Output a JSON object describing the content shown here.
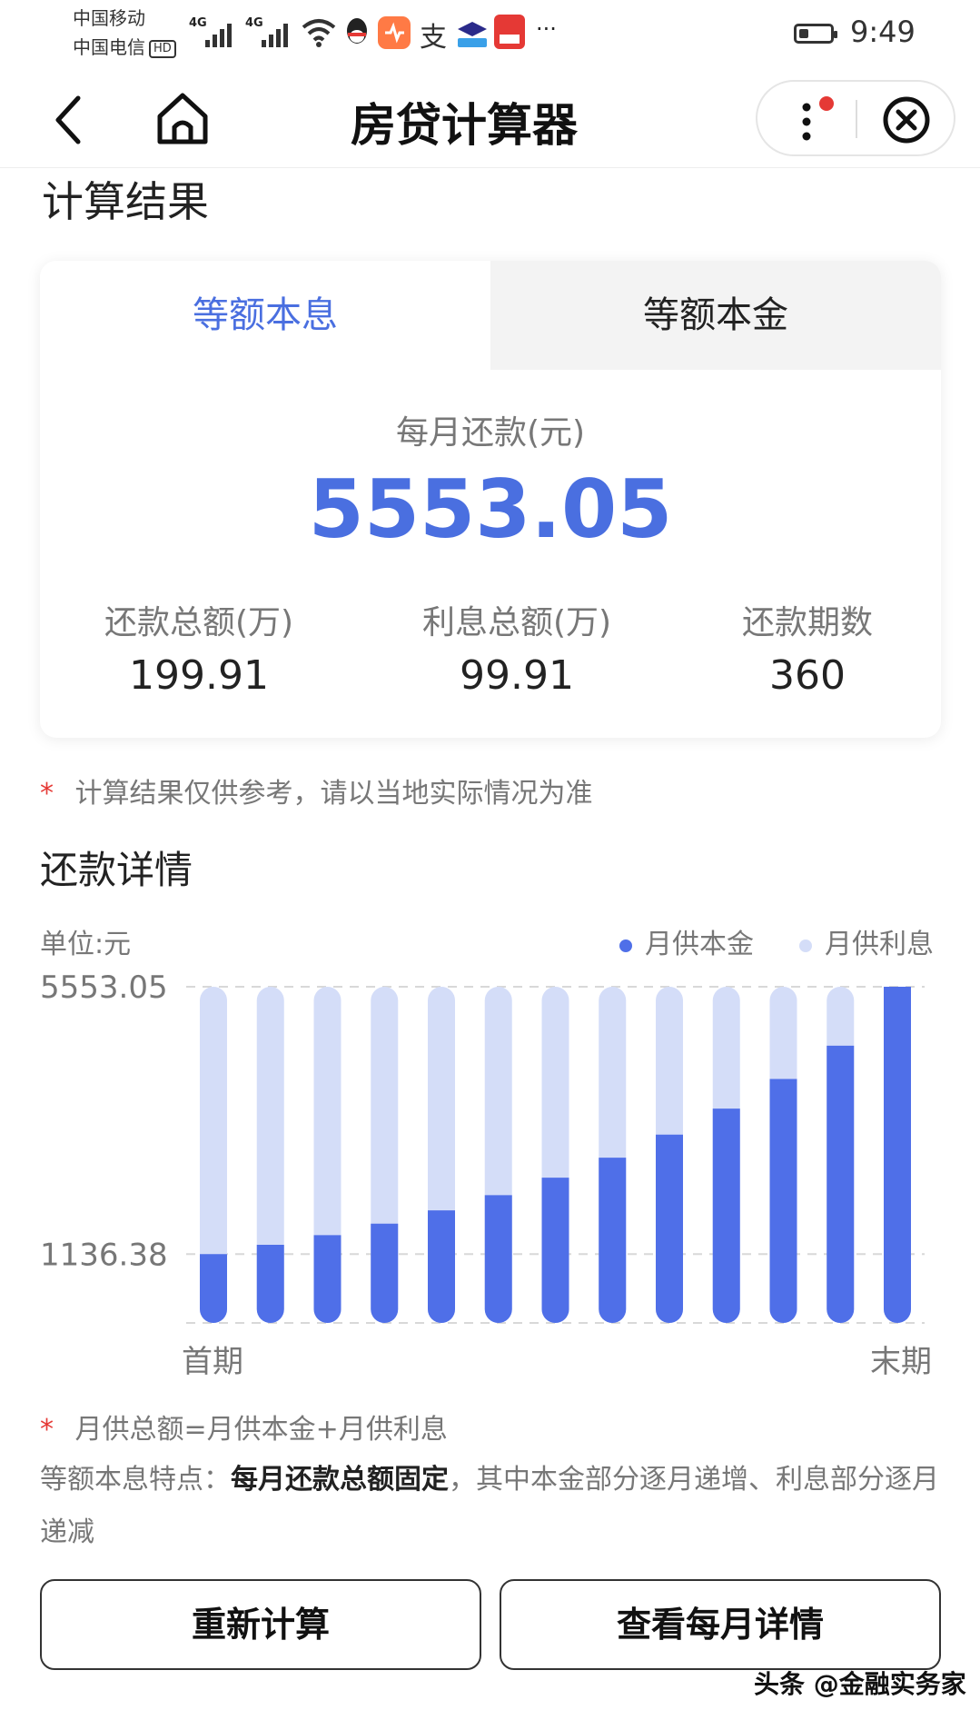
{
  "status_bar": {
    "carrier1": "中国移动",
    "carrier2": "中国电信",
    "hd": "HD",
    "signal1": "4G",
    "signal2": "4G",
    "time": "9:49",
    "more": "···"
  },
  "header": {
    "title": "房贷计算器"
  },
  "result": {
    "section_title": "计算结果",
    "tabs": [
      "等额本息",
      "等额本金"
    ],
    "monthly_label": "每月还款(元)",
    "monthly_value": "5553.05",
    "stats": [
      {
        "label": "还款总额(万)",
        "value": "199.91"
      },
      {
        "label": "利息总额(万)",
        "value": "99.91"
      },
      {
        "label": "还款期数",
        "value": "360"
      }
    ],
    "disclaimer_star": "*",
    "disclaimer": "计算结果仅供参考，请以当地实际情况为准"
  },
  "details": {
    "section_title": "还款详情",
    "unit": "单位:元",
    "formula_star": "*",
    "formula": "月供总额=月供本金+月供利息",
    "feature_prefix": "等额本息特点：",
    "feature_bold": "每月还款总额固定",
    "feature_rest": "，其中本金部分逐月递增、利息部分逐月递减"
  },
  "chart_data": {
    "type": "bar",
    "stacked": true,
    "categories": [
      "首期",
      "",
      "",
      "",
      "",
      "",
      "",
      "",
      "",
      "",
      "",
      "",
      "末期"
    ],
    "series": [
      {
        "name": "月供本金",
        "color": "#4f6fe8",
        "values": [
          1136.38,
          1290,
          1450,
          1640,
          1860,
          2110,
          2400,
          2730,
          3110,
          3540,
          4030,
          4580,
          5553.05
        ]
      },
      {
        "name": "月供利息",
        "color": "#d4ddf8",
        "values": [
          4416.67,
          4263.05,
          4103.05,
          3913.05,
          3693.05,
          3443.05,
          3153.05,
          2823.05,
          2443.05,
          2013.05,
          1523.05,
          973.05,
          0
        ]
      }
    ],
    "y_ticks": [
      "5553.05",
      "1136.38"
    ],
    "ylim": [
      0,
      5553.05
    ],
    "x_labels": [
      "首期",
      "末期"
    ],
    "legend_position": "top-right"
  },
  "buttons": {
    "recalc": "重新计算",
    "monthly_detail": "查看每月详情"
  },
  "watermark": "头条 @金融实务家",
  "colors": {
    "accent": "#4a6fe0",
    "principal": "#4f6fe8",
    "interest": "#d4ddf8",
    "star": "#e53935"
  }
}
